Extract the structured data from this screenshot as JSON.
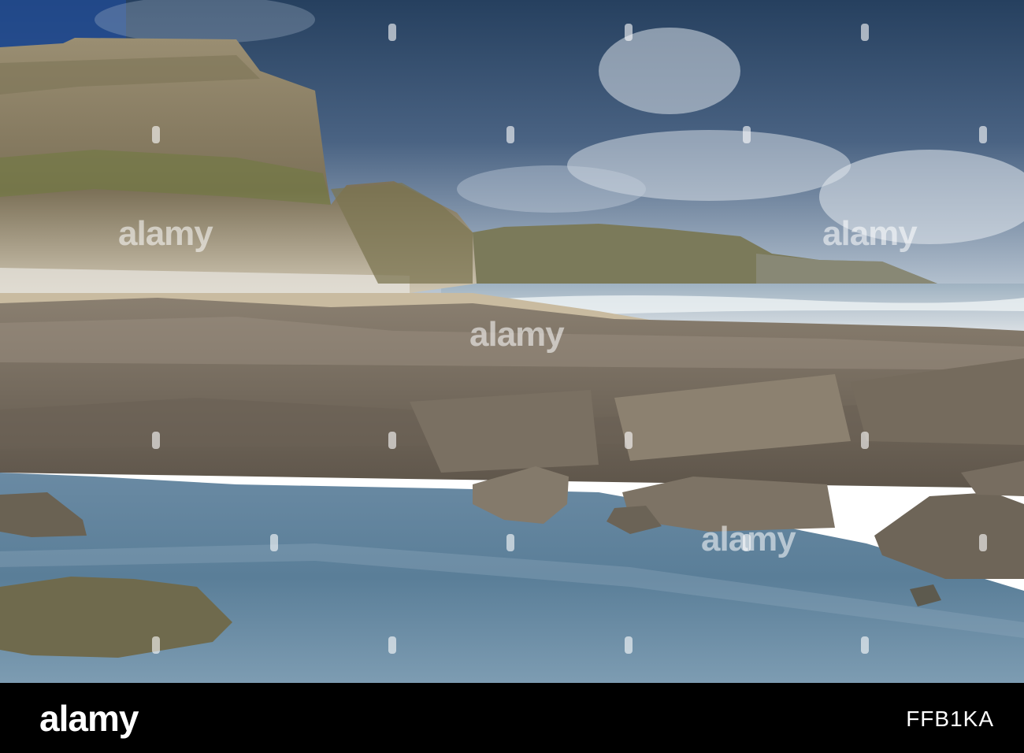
{
  "watermark": {
    "text": "alamy"
  },
  "footer": {
    "brand": "alamy",
    "image_code": "FFB1KA"
  },
  "colors": {
    "sky_top": "#2b4a73",
    "sky_light": "#b8c8d8",
    "cliff": "#8a7f66",
    "sea": "#6d8ea8",
    "pool": "#4f7590",
    "rocks": "#7a6f60"
  }
}
